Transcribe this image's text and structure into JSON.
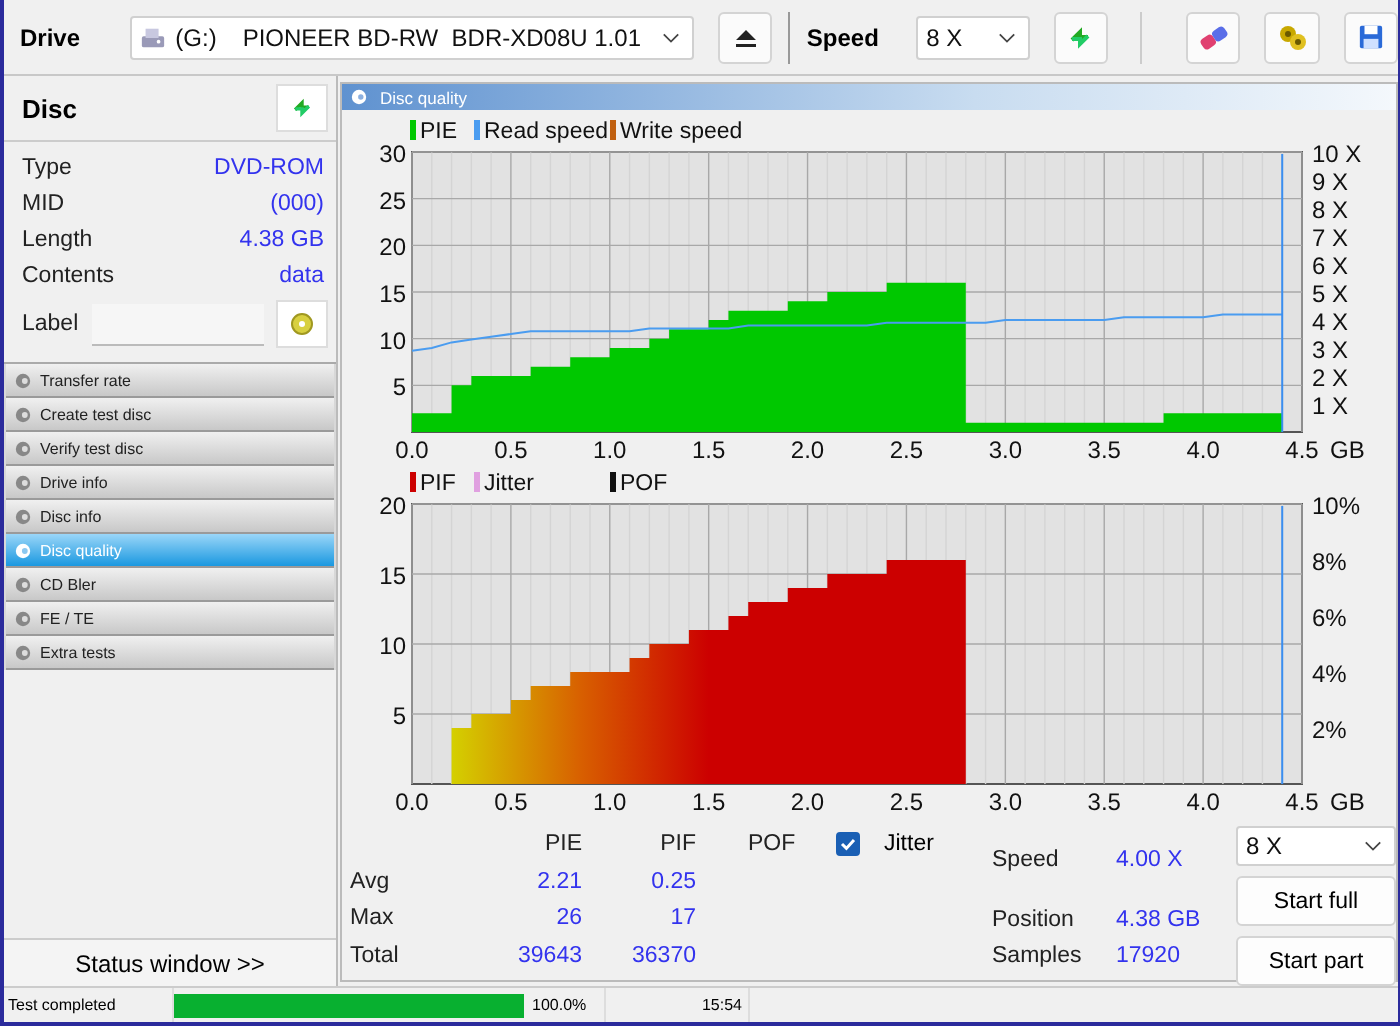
{
  "toolbar": {
    "drive_label": "Drive",
    "drive": {
      "letter": "(G:)",
      "name": "PIONEER BD-RW  BDR-XD08U 1.01"
    },
    "speed_label": "Speed",
    "speed": "8 X"
  },
  "disc": {
    "title": "Disc",
    "fields": [
      {
        "label": "Type",
        "value": "DVD-ROM"
      },
      {
        "label": "MID",
        "value": "(000)"
      },
      {
        "label": "Length",
        "value": "4.38 GB"
      },
      {
        "label": "Contents",
        "value": "data"
      }
    ],
    "label_field": {
      "label": "Label"
    }
  },
  "menu": [
    {
      "label": "Transfer rate",
      "selected": false
    },
    {
      "label": "Create test disc",
      "selected": false
    },
    {
      "label": "Verify test disc",
      "selected": false
    },
    {
      "label": "Drive info",
      "selected": false
    },
    {
      "label": "Disc info",
      "selected": false
    },
    {
      "label": "Disc quality",
      "selected": true
    },
    {
      "label": "CD Bler",
      "selected": false
    },
    {
      "label": "FE / TE",
      "selected": false
    },
    {
      "label": "Extra tests",
      "selected": false
    }
  ],
  "status_window_button": "Status window >>",
  "panel": {
    "title": "Disc quality",
    "charts": [
      {
        "legend_extra": [
          {
            "label": "Write speed",
            "color": "#c06010"
          }
        ],
        "x_unit": "GB",
        "chart_data": {
          "type": "area",
          "x": [
            0,
            0.1,
            0.2,
            0.3,
            0.4,
            0.5,
            0.6,
            0.7,
            0.8,
            0.9,
            1.0,
            1.1,
            1.2,
            1.3,
            1.4,
            1.5,
            1.6,
            1.7,
            1.8,
            1.9,
            2.0,
            2.1,
            2.2,
            2.3,
            2.4,
            2.5,
            2.6,
            2.7,
            2.8,
            2.9,
            3.0,
            3.1,
            3.2,
            3.3,
            3.4,
            3.5,
            3.6,
            3.7,
            3.8,
            3.9,
            4.0,
            4.1,
            4.2,
            4.3,
            4.4
          ],
          "legend": "top-left",
          "xlim": [
            0,
            4.5
          ],
          "ylim": [
            0,
            30
          ],
          "y2lim": [
            0,
            10
          ],
          "grid": true,
          "ref_lines": [
            {
              "axis": "x",
              "value": 4.4,
              "color": "#3a8ef0"
            }
          ],
          "y2ticks": [
            {
              "value": 1,
              "label": "1 X"
            },
            {
              "value": 2,
              "label": "2 X"
            },
            {
              "value": 3,
              "label": "3 X"
            },
            {
              "value": 4,
              "label": "4 X"
            },
            {
              "value": 5,
              "label": "5 X"
            },
            {
              "value": 6,
              "label": "6 X"
            },
            {
              "value": 7,
              "label": "7 X"
            },
            {
              "value": 8,
              "label": "8 X"
            },
            {
              "value": 9,
              "label": "9 X"
            },
            {
              "value": 10,
              "label": "10 X"
            }
          ],
          "xticks": [
            {
              "value": 0,
              "label": "0.0"
            },
            {
              "value": 0.5,
              "label": "0.5"
            },
            {
              "value": 1,
              "label": "1.0"
            },
            {
              "value": 1.5,
              "label": "1.5"
            },
            {
              "value": 2,
              "label": "2.0"
            },
            {
              "value": 2.5,
              "label": "2.5"
            },
            {
              "value": 3,
              "label": "3.0"
            },
            {
              "value": 3.5,
              "label": "3.5"
            },
            {
              "value": 4,
              "label": "4.0"
            },
            {
              "value": 4.5,
              "label": "4.5"
            }
          ],
          "yticks": [
            5,
            10,
            15,
            20,
            25,
            30
          ],
          "series": [
            {
              "name": "PIE",
              "color": "#00c800",
              "values": [
                2,
                2,
                5,
                6,
                6,
                6,
                7,
                7,
                8,
                8,
                9,
                9,
                10,
                11,
                11,
                12,
                13,
                13,
                13,
                14,
                14,
                15,
                15,
                15,
                16,
                16,
                16,
                16,
                1,
                1,
                1,
                1,
                1,
                1,
                1,
                1,
                1,
                1,
                2,
                2,
                2,
                2,
                2,
                2,
                2
              ]
            },
            {
              "name": "Read speed",
              "type": "line",
              "color": "#4a9cf0",
              "axis": "y2",
              "values": [
                2.9,
                3.0,
                3.2,
                3.3,
                3.4,
                3.5,
                3.6,
                3.6,
                3.6,
                3.6,
                3.6,
                3.6,
                3.7,
                3.7,
                3.7,
                3.7,
                3.7,
                3.8,
                3.8,
                3.8,
                3.8,
                3.8,
                3.8,
                3.8,
                3.9,
                3.9,
                3.9,
                3.9,
                3.9,
                3.9,
                4.0,
                4.0,
                4.0,
                4.0,
                4.0,
                4.0,
                4.1,
                4.1,
                4.1,
                4.1,
                4.1,
                4.2,
                4.2,
                4.2,
                4.2
              ]
            }
          ]
        }
      },
      {
        "legend_extra": [
          {
            "label": "Jitter",
            "color": "#e0a0e0"
          },
          {
            "label": "POF",
            "color": "#101010"
          }
        ],
        "x_unit": "GB",
        "chart_data": {
          "type": "area",
          "x": [
            0,
            0.1,
            0.2,
            0.3,
            0.4,
            0.5,
            0.6,
            0.7,
            0.8,
            0.9,
            1.0,
            1.1,
            1.2,
            1.3,
            1.4,
            1.5,
            1.6,
            1.7,
            1.8,
            1.9,
            2.0,
            2.1,
            2.2,
            2.3,
            2.4,
            2.5,
            2.6,
            2.7,
            2.8,
            2.9,
            3.0,
            3.1,
            3.2,
            3.3,
            3.4,
            3.5,
            3.6,
            3.7,
            3.8,
            3.9,
            4.0,
            4.1,
            4.2,
            4.3,
            4.4
          ],
          "legend": "top-left",
          "xlim": [
            0,
            4.5
          ],
          "ylim": [
            0,
            20
          ],
          "y2lim": [
            0,
            10
          ],
          "grid": true,
          "ref_lines": [
            {
              "axis": "x",
              "value": 4.4,
              "color": "#3a8ef0"
            }
          ],
          "y2ticks": [
            {
              "value": 2,
              "label": "2%"
            },
            {
              "value": 4,
              "label": "4%"
            },
            {
              "value": 6,
              "label": "6%"
            },
            {
              "value": 8,
              "label": "8%"
            },
            {
              "value": 10,
              "label": "10%"
            }
          ],
          "xticks": [
            {
              "value": 0,
              "label": "0.0"
            },
            {
              "value": 0.5,
              "label": "0.5"
            },
            {
              "value": 1,
              "label": "1.0"
            },
            {
              "value": 1.5,
              "label": "1.5"
            },
            {
              "value": 2,
              "label": "2.0"
            },
            {
              "value": 2.5,
              "label": "2.5"
            },
            {
              "value": 3,
              "label": "3.0"
            },
            {
              "value": 3.5,
              "label": "3.5"
            },
            {
              "value": 4,
              "label": "4.0"
            },
            {
              "value": 4.5,
              "label": "4.5"
            }
          ],
          "yticks": [
            5,
            10,
            15,
            20
          ],
          "series": [
            {
              "name": "PIF",
              "color": "#cc0000",
              "values": [
                0,
                0,
                4,
                5,
                5,
                6,
                7,
                7,
                8,
                8,
                8,
                9,
                10,
                10,
                11,
                11,
                12,
                13,
                13,
                14,
                14,
                15,
                15,
                15,
                16,
                16,
                16,
                16,
                0,
                0,
                0,
                0,
                0,
                0,
                0,
                0,
                0,
                0,
                0,
                0,
                0,
                0,
                0,
                0,
                0
              ]
            }
          ]
        }
      }
    ],
    "stats": {
      "columns": [
        "PIE",
        "PIF",
        "POF"
      ],
      "jitter": {
        "label": "Jitter",
        "checked": true
      },
      "rows": [
        {
          "label": "Avg",
          "values": [
            "2.21",
            "0.25"
          ]
        },
        {
          "label": "Max",
          "values": [
            "26",
            "17"
          ]
        },
        {
          "label": "Total",
          "values": [
            "39643",
            "36370"
          ]
        }
      ]
    },
    "readings": [
      {
        "label": "Speed",
        "value": "4.00 X"
      },
      {
        "label": "Position",
        "value": "4.38 GB"
      },
      {
        "label": "Samples",
        "value": "17920"
      }
    ],
    "speed_select": "8 X",
    "buttons": [
      "Start full",
      "Start part"
    ]
  },
  "status_bar": {
    "message": "Test completed",
    "progress": {
      "level": 1.0
    },
    "percent": "100.0%",
    "time": "15:54"
  }
}
